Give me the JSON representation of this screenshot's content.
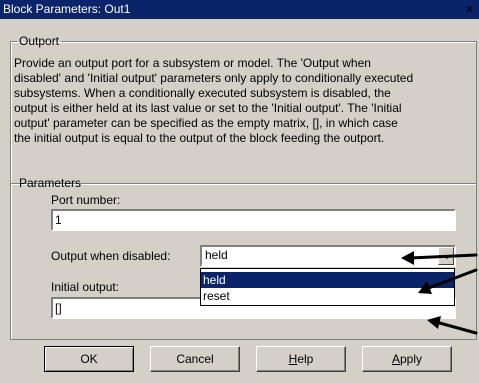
{
  "window": {
    "title": "Block Parameters: Out1",
    "close_glyph": "×"
  },
  "outport_group": {
    "legend": "Outport",
    "description_lines": [
      "Provide an output port for a subsystem or model.  The 'Output when",
      "disabled' and 'Initial output' parameters only apply to conditionally executed",
      "subsystems. When a conditionally executed subsystem is disabled, the",
      "output is either held at its last value or set to the 'Initial output'.  The 'Initial",
      "output' parameter can be specified as the empty matrix, [], in which case",
      "the initial output is equal to the output of the block feeding the outport."
    ]
  },
  "parameters_group": {
    "legend": "Parameters",
    "port_number": {
      "label": "Port number:",
      "value": "1"
    },
    "output_when_disabled": {
      "label": "Output when disabled:",
      "value": "held",
      "options": [
        {
          "label": "held",
          "selected": true
        },
        {
          "label": "reset",
          "selected": false
        }
      ]
    },
    "initial_output": {
      "label": "Initial output:",
      "value": "[]"
    }
  },
  "buttons": {
    "ok": "OK",
    "cancel": "Cancel",
    "help": {
      "mnemonic": "H",
      "rest": "elp"
    },
    "apply": {
      "mnemonic": "A",
      "rest": "pply"
    }
  }
}
